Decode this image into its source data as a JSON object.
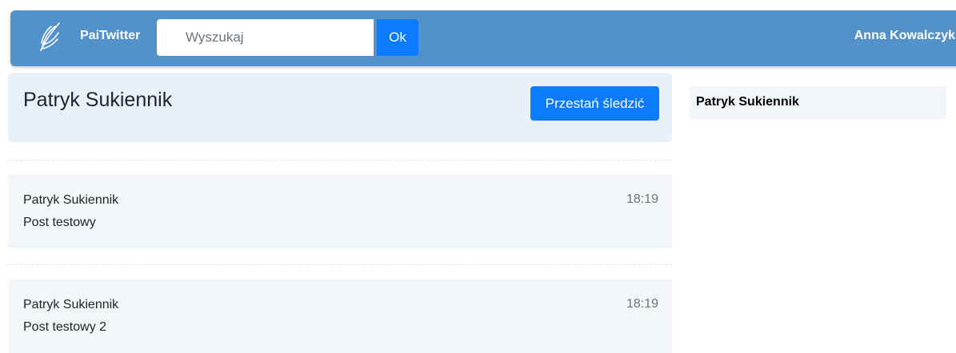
{
  "header": {
    "brand": "PaiTwitter",
    "logo_icon": "feather-wings-icon",
    "search": {
      "placeholder": "Wyszukaj",
      "value": ""
    },
    "search_button": "Ok",
    "user_name": "Anna Kowalczyk"
  },
  "profile": {
    "name": "Patryk Sukiennik",
    "unfollow_label": "Przestań śledzić"
  },
  "posts": [
    {
      "author": "Patryk Sukiennik",
      "time": "18:19",
      "content": "Post testowy"
    },
    {
      "author": "Patryk Sukiennik",
      "time": "18:19",
      "content": "Post testowy 2"
    }
  ],
  "sidebar": {
    "items": [
      "Patryk Sukiennik"
    ]
  },
  "colors": {
    "navbar": "#5391cb",
    "primary_button": "#0d7bff",
    "card_background": "#e8f0f9",
    "post_background": "#f2f6fb"
  }
}
